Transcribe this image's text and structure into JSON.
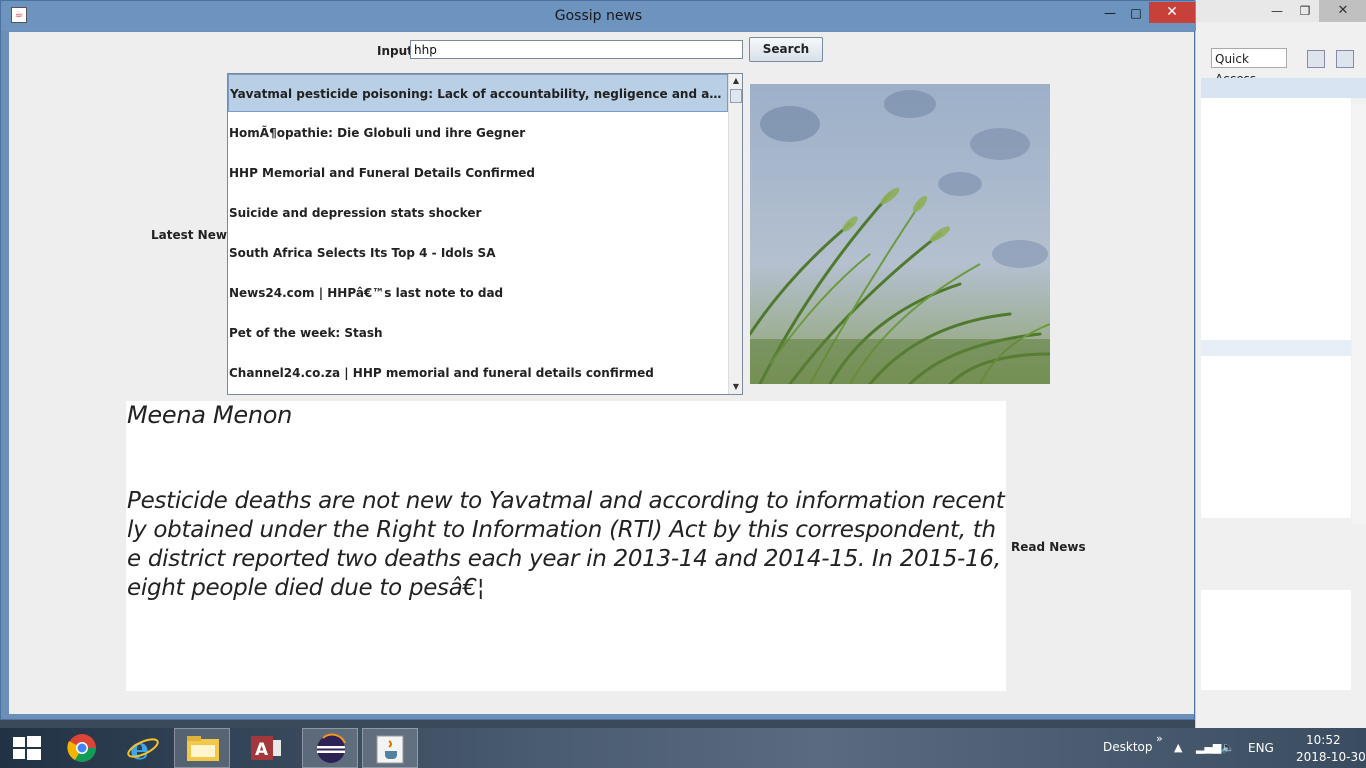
{
  "window": {
    "title": "Gossip news",
    "minimize": "—",
    "maximize": "□",
    "close": "✕"
  },
  "search": {
    "label": "Input",
    "value": "hhp",
    "button_label": "Search"
  },
  "latest_news_label": "Latest News",
  "news_items": [
    "Yavatmal pesticide poisoning: Lack of accountability, negligence and abysmal medical ...",
    "HomÃ¶opathie: Die Globuli und ihre Gegner",
    "HHP Memorial and Funeral Details Confirmed",
    "Suicide and depression stats shocker",
    "South Africa Selects Its Top 4 - Idols SA",
    "News24.com | HHPâ€™s last note to dad",
    "Pet of the week: Stash",
    "Channel24.co.za | HHP memorial and funeral details confirmed"
  ],
  "article": {
    "author": "Meena Menon",
    "body": "Pesticide deaths are not new to Yavatmal and according to information recently obtained under the Right to Information (RTI) Act by this correspondent, the district reported two deaths each year in 2013-14 and 2014-15. In 2015-16, eight people died due to pesâ€¦"
  },
  "read_news_label": "Read News",
  "background_app": {
    "quick_access": "Quick Access"
  },
  "taskbar": {
    "desktop_label": "Desktop",
    "language": "ENG",
    "time": "10:52",
    "date": "2018-10-30",
    "apps": [
      "windows-start-icon",
      "chrome-icon",
      "internet-explorer-icon",
      "file-explorer-icon",
      "access-icon",
      "eclipse-icon",
      "java-icon"
    ]
  },
  "colors": {
    "title_bar": "#6d93bf",
    "close_button": "#c8403a",
    "selected_item": "#b8cfe5",
    "content_bg": "#eeeeee"
  }
}
